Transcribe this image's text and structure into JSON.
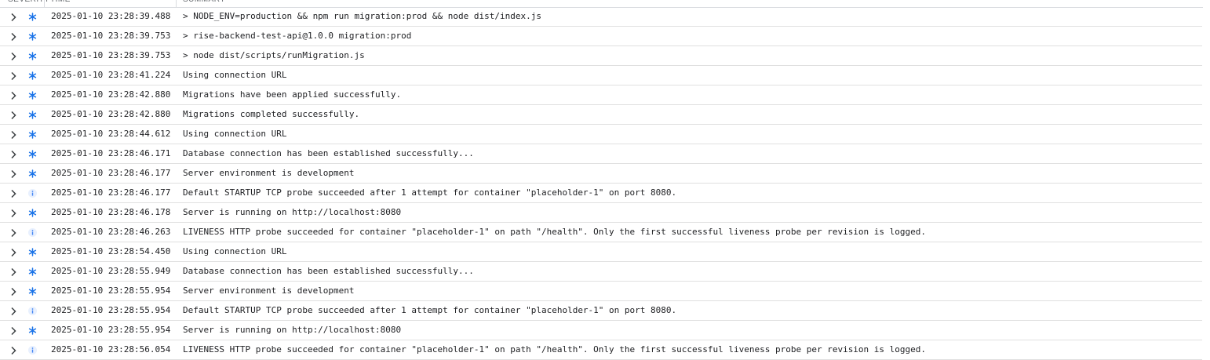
{
  "header": {
    "severity": "SEVERITY",
    "time": "TIME",
    "summary": "SUMMARY"
  },
  "colors": {
    "default_icon": "#1a73e8",
    "info_icon": "#4285f4",
    "text": "#202124",
    "chevron": "#3c4043",
    "row_border": "#e0e0e0"
  },
  "icons": {
    "default": "asterisk-icon",
    "info": "info-icon",
    "expand": "chevron-right-icon"
  },
  "rows": [
    {
      "severity": "default",
      "time": "2025-01-10 23:28:39.488",
      "message": "> NODE_ENV=production && npm run migration:prod && node dist/index.js"
    },
    {
      "severity": "default",
      "time": "2025-01-10 23:28:39.753",
      "message": "> rise-backend-test-api@1.0.0 migration:prod"
    },
    {
      "severity": "default",
      "time": "2025-01-10 23:28:39.753",
      "message": "> node dist/scripts/runMigration.js"
    },
    {
      "severity": "default",
      "time": "2025-01-10 23:28:41.224",
      "message": "Using connection URL"
    },
    {
      "severity": "default",
      "time": "2025-01-10 23:28:42.880",
      "message": "Migrations have been applied successfully."
    },
    {
      "severity": "default",
      "time": "2025-01-10 23:28:42.880",
      "message": "Migrations completed successfully."
    },
    {
      "severity": "default",
      "time": "2025-01-10 23:28:44.612",
      "message": "Using connection URL"
    },
    {
      "severity": "default",
      "time": "2025-01-10 23:28:46.171",
      "message": "Database connection has been established successfully..."
    },
    {
      "severity": "default",
      "time": "2025-01-10 23:28:46.177",
      "message": "Server environment is development"
    },
    {
      "severity": "info",
      "time": "2025-01-10 23:28:46.177",
      "message": "Default STARTUP TCP probe succeeded after 1 attempt for container \"placeholder-1\" on port 8080."
    },
    {
      "severity": "default",
      "time": "2025-01-10 23:28:46.178",
      "message": "Server is running on http://localhost:8080"
    },
    {
      "severity": "info",
      "time": "2025-01-10 23:28:46.263",
      "message": "LIVENESS HTTP probe succeeded for container \"placeholder-1\" on path \"/health\". Only the first successful liveness probe per revision is logged."
    },
    {
      "severity": "default",
      "time": "2025-01-10 23:28:54.450",
      "message": "Using connection URL"
    },
    {
      "severity": "default",
      "time": "2025-01-10 23:28:55.949",
      "message": "Database connection has been established successfully..."
    },
    {
      "severity": "default",
      "time": "2025-01-10 23:28:55.954",
      "message": "Server environment is development"
    },
    {
      "severity": "info",
      "time": "2025-01-10 23:28:55.954",
      "message": "Default STARTUP TCP probe succeeded after 1 attempt for container \"placeholder-1\" on port 8080."
    },
    {
      "severity": "default",
      "time": "2025-01-10 23:28:55.954",
      "message": "Server is running on http://localhost:8080"
    },
    {
      "severity": "info",
      "time": "2025-01-10 23:28:56.054",
      "message": "LIVENESS HTTP probe succeeded for container \"placeholder-1\" on path \"/health\". Only the first successful liveness probe per revision is logged."
    }
  ]
}
